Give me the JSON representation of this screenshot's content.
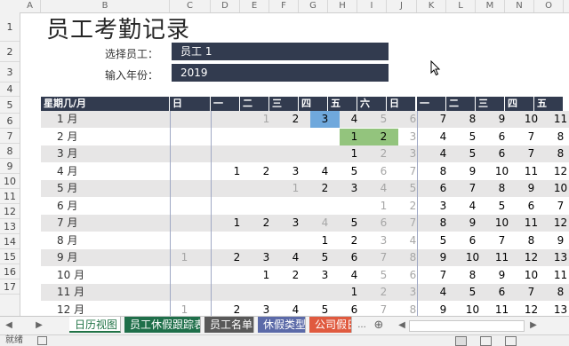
{
  "columns": [
    "A",
    "B",
    "C",
    "D",
    "E",
    "F",
    "G",
    "H",
    "I",
    "J",
    "K",
    "L",
    "M",
    "N",
    "O",
    "P",
    "Q"
  ],
  "rows": [
    "1",
    "2",
    "3",
    "4",
    "5",
    "6",
    "7",
    "8",
    "9",
    "10",
    "11",
    "12",
    "13",
    "14",
    "15",
    "16",
    "17"
  ],
  "title": "员工考勤记录",
  "employee_label": "选择员工：",
  "employee_value": "员工 1",
  "year_label": "输入年份：",
  "year_value": "2019",
  "header": {
    "first": "星期几/月",
    "days": [
      "日",
      "一",
      "二",
      "三",
      "四",
      "五",
      "六",
      "日",
      "一",
      "二",
      "三",
      "四",
      "五"
    ]
  },
  "months": [
    {
      "label": "1 月",
      "cells": [
        "",
        "",
        "1",
        "2",
        "3",
        "4",
        "5",
        "6",
        "7",
        "8",
        "9",
        "10",
        "11"
      ],
      "dim": [
        2,
        6,
        7
      ],
      "blue": [
        4
      ],
      "green": []
    },
    {
      "label": "2 月",
      "cells": [
        "",
        "",
        "",
        "",
        "",
        "1",
        "2",
        "3",
        "4",
        "5",
        "6",
        "7",
        "8"
      ],
      "dim": [
        7
      ],
      "blue": [],
      "green": [
        5,
        6
      ]
    },
    {
      "label": "3 月",
      "cells": [
        "",
        "",
        "",
        "",
        "",
        "1",
        "2",
        "3",
        "4",
        "5",
        "6",
        "7",
        "8"
      ],
      "dim": [
        6,
        7
      ],
      "blue": [],
      "green": []
    },
    {
      "label": "4 月",
      "cells": [
        "",
        "1",
        "2",
        "3",
        "4",
        "5",
        "6",
        "7",
        "8",
        "9",
        "10",
        "11",
        "12"
      ],
      "dim": [
        6,
        7
      ],
      "blue": [],
      "green": []
    },
    {
      "label": "5 月",
      "cells": [
        "",
        "",
        "",
        "1",
        "2",
        "3",
        "4",
        "5",
        "6",
        "7",
        "8",
        "9",
        "10"
      ],
      "dim": [
        3,
        6,
        7
      ],
      "blue": [],
      "green": []
    },
    {
      "label": "6 月",
      "cells": [
        "",
        "",
        "",
        "",
        "",
        "",
        "1",
        "2",
        "3",
        "4",
        "5",
        "6",
        "7"
      ],
      "dim": [
        6,
        7
      ],
      "blue": [],
      "green": []
    },
    {
      "label": "7 月",
      "cells": [
        "",
        "1",
        "2",
        "3",
        "4",
        "5",
        "6",
        "7",
        "8",
        "9",
        "10",
        "11",
        "12"
      ],
      "dim": [
        4,
        6,
        7
      ],
      "blue": [],
      "green": []
    },
    {
      "label": "8 月",
      "cells": [
        "",
        "",
        "",
        "",
        "1",
        "2",
        "3",
        "4",
        "5",
        "6",
        "7",
        "8",
        "9"
      ],
      "dim": [
        6,
        7
      ],
      "blue": [],
      "green": []
    },
    {
      "label": "9 月",
      "cells": [
        "1",
        "2",
        "3",
        "4",
        "5",
        "6",
        "7",
        "8",
        "9",
        "10",
        "11",
        "12",
        "13"
      ],
      "dim": [
        0,
        6,
        7
      ],
      "blue": [],
      "green": []
    },
    {
      "label": "10 月",
      "cells": [
        "",
        "",
        "1",
        "2",
        "3",
        "4",
        "5",
        "6",
        "7",
        "8",
        "9",
        "10",
        "11"
      ],
      "dim": [
        6,
        7
      ],
      "blue": [],
      "green": []
    },
    {
      "label": "11 月",
      "cells": [
        "",
        "",
        "",
        "",
        "",
        "1",
        "2",
        "3",
        "4",
        "5",
        "6",
        "7",
        "8"
      ],
      "dim": [
        6,
        7
      ],
      "blue": [],
      "green": []
    },
    {
      "label": "12 月",
      "cells": [
        "1",
        "2",
        "3",
        "4",
        "5",
        "6",
        "7",
        "8",
        "9",
        "10",
        "11",
        "12",
        "13"
      ],
      "dim": [
        0,
        6,
        7
      ],
      "blue": [],
      "green": []
    }
  ],
  "tabs": [
    {
      "label": "日历视图",
      "bg": "#ffffff",
      "fg": "#217346",
      "active": true
    },
    {
      "label": "员工休假跟踪表",
      "bg": "#1f6f4a",
      "fg": "#ffffff",
      "active": false
    },
    {
      "label": "员工名单",
      "bg": "#595959",
      "fg": "#ffffff",
      "active": false
    },
    {
      "label": "休假类型",
      "bg": "#5b6aa8",
      "fg": "#ffffff",
      "active": false
    },
    {
      "label": "公司假日",
      "bg": "#e05a3f",
      "fg": "#ffffff",
      "active": false
    }
  ],
  "tab_more": "...",
  "status_text": "就绪",
  "colors": {
    "header_dark": "#323b4f",
    "shade": "#e7e6e6",
    "highlight_blue": "#6fa8dc",
    "highlight_green": "#93c47d"
  }
}
